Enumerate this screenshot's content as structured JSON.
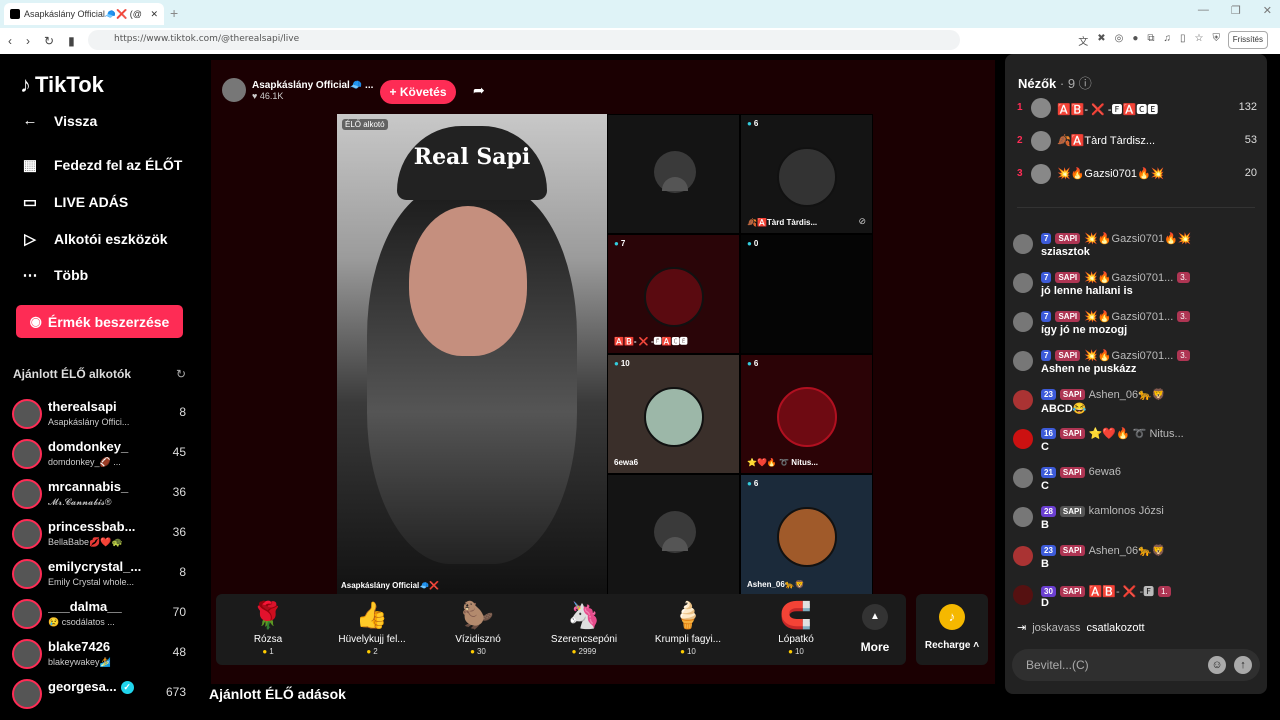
{
  "browser": {
    "tab_title": "Asapkáslány Official🧢❌ (@",
    "url": "https://www.tiktok.com/@therealsapi/live",
    "refresh_label": "Frissítés"
  },
  "sidebar": {
    "logo": "TikTok",
    "back": "Vissza",
    "nav": [
      {
        "label": "Fedezd fel az ÉLŐT",
        "icon": "calendar-icon"
      },
      {
        "label": "LIVE ADÁS",
        "icon": "video-icon"
      },
      {
        "label": "Alkotói eszközök",
        "icon": "creator-tools-icon"
      },
      {
        "label": "Több",
        "icon": "more-dots-icon"
      }
    ],
    "coins_button": "Érmék beszerzése",
    "recommended_title": "Ajánlott ÉLŐ alkotók",
    "creators": [
      {
        "name": "therealsapi",
        "sub": "Asapkáslány Offici...",
        "count": "8"
      },
      {
        "name": "domdonkey_",
        "sub": "domdonkey_🏈 ...",
        "count": "45"
      },
      {
        "name": "mrcannabis_",
        "sub": "𝓜𝓻.𝓒𝓪𝓷𝓷𝓪𝓫𝓲𝓼®",
        "count": "36"
      },
      {
        "name": "princessbab...",
        "sub": "BellaBabe💋❤️🐢",
        "count": "36"
      },
      {
        "name": "emilycrystal_...",
        "sub": "Emily Crystal whole...",
        "count": "8"
      },
      {
        "name": "___dalma__",
        "sub": "😢 csodálatos ...",
        "count": "70"
      },
      {
        "name": "blake7426",
        "sub": "blakeywakey🏄",
        "count": "48"
      },
      {
        "name": "georgesa...",
        "sub": "",
        "count": "673"
      }
    ]
  },
  "main": {
    "host_name": "Asapkáslány Official🧢 ...",
    "host_likes": "46.1K",
    "follow_button": "+ Követés",
    "host_tile": {
      "badge": "ÉLŐ alkotó",
      "cap_text": "Real Sapi",
      "name": "Asapkáslány Official🧢❌"
    },
    "guests": [
      {
        "badge": "",
        "label": ""
      },
      {
        "badge": "6",
        "label": "🍂🅰️Tàrd Tàrdis..."
      },
      {
        "badge": "7",
        "label": "🅰️🅱️- ❌ -🅵🅰️🅲🅴"
      },
      {
        "badge": "0",
        "label": ""
      },
      {
        "badge": "10",
        "label": "6ewa6"
      },
      {
        "badge": "6",
        "label": "⭐❤️🔥 ➰ Nitus..."
      },
      {
        "badge": "",
        "label": ""
      },
      {
        "badge": "6",
        "label": "Ashen_06🐆🦁"
      }
    ],
    "gifts": [
      {
        "name": "Rózsa",
        "price": "1",
        "icon": "🌹"
      },
      {
        "name": "Hüvelykujj fel...",
        "price": "2",
        "icon": "👍"
      },
      {
        "name": "Vízidisznó",
        "price": "30",
        "icon": "🦫"
      },
      {
        "name": "Szerencsepóni",
        "price": "2999",
        "icon": "🦄"
      },
      {
        "name": "Krumpli fagyi...",
        "price": "10",
        "icon": "🍦"
      },
      {
        "name": "Lópatkó",
        "price": "10",
        "icon": "🧲"
      }
    ],
    "more_label": "More",
    "recharge_label": "Recharge",
    "recommended_live": "Ajánlott ÉLŐ adások"
  },
  "chat": {
    "viewers_label": "Nézők",
    "viewers_count": "9",
    "top_viewers": [
      {
        "rank": "1",
        "name": "🅰️🅱️- ❌ -🅵🅰️🅲🅴",
        "score": "132"
      },
      {
        "rank": "2",
        "name": "🍂🅰️Tàrd Tàrdisz...",
        "score": "53"
      },
      {
        "rank": "3",
        "name": "💥🔥Gazsi0701🔥💥",
        "score": "20"
      }
    ],
    "messages": [
      {
        "lvl": "7",
        "fan": "SAPI",
        "user": "💥🔥Gazsi0701🔥💥",
        "rank": "",
        "text": "sziasztok"
      },
      {
        "lvl": "7",
        "fan": "SAPI",
        "user": "💥🔥Gazsi0701...",
        "rank": "3.",
        "text": "jó lenne hallani is"
      },
      {
        "lvl": "7",
        "fan": "SAPI",
        "user": "💥🔥Gazsi0701...",
        "rank": "3.",
        "text": "így jó ne mozogj"
      },
      {
        "lvl": "7",
        "fan": "SAPI",
        "user": "💥🔥Gazsi0701...",
        "rank": "3.",
        "text": "Ashen ne puskázz"
      },
      {
        "lvl": "23",
        "fan": "SAPI",
        "user": "Ashen_06🐆🦁",
        "rank": "",
        "text": "ABCD😂"
      },
      {
        "lvl": "16",
        "fan": "SAPI",
        "user": "⭐❤️🔥 ➰ Nitus...",
        "rank": "",
        "text": "C"
      },
      {
        "lvl": "21",
        "fan": "SAPI",
        "user": "6ewa6",
        "rank": "",
        "text": "C"
      },
      {
        "lvl": "28",
        "fan": "SAPI",
        "user": "kamlonos Józsi",
        "rank": "",
        "text": "B"
      },
      {
        "lvl": "23",
        "fan": "SAPI",
        "user": "Ashen_06🐆🦁",
        "rank": "",
        "text": "B"
      },
      {
        "lvl": "30",
        "fan": "SAPI",
        "user": "🅰️🅱️- ❌ -🅵",
        "rank": "1.",
        "text": "D"
      }
    ],
    "join_user": "joskavass",
    "join_text": "csatlakozott",
    "input_placeholder": "Bevitel...(C)"
  },
  "colors": {
    "accent": "#fe2c55",
    "stage_bg": "#1b0002",
    "panel_bg": "#222222"
  }
}
